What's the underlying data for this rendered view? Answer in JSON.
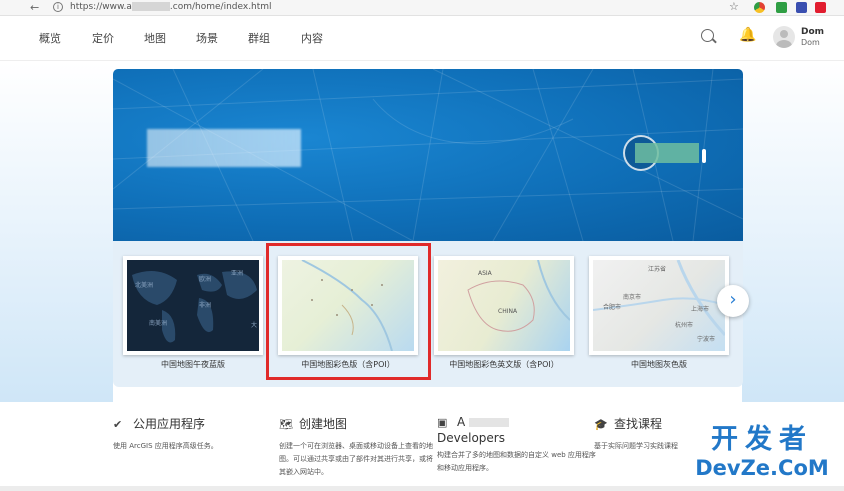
{
  "browser": {
    "url_prefix": "https://www.a",
    "url_suffix": ".com/home/index.html"
  },
  "nav": {
    "items": [
      "概览",
      "定价",
      "地图",
      "场景",
      "群组",
      "内容"
    ],
    "user_name": "Dom",
    "user_handle": "Dom"
  },
  "gallery": {
    "cards": [
      {
        "label": "中国地图午夜蓝版",
        "map_text": [
          "北美洲",
          "欧洲",
          "亚洲",
          "非洲",
          "南美洲",
          "大"
        ]
      },
      {
        "label": "中国地图彩色版（含POI）",
        "map_text": []
      },
      {
        "label": "中国地图彩色英文版（含POI）",
        "map_text": [
          "ASIA",
          "CHINA"
        ]
      },
      {
        "label": "中国地图灰色版",
        "map_text": [
          "江苏省",
          "南京市",
          "合肥市",
          "上海市",
          "杭州市",
          "宁波市"
        ]
      }
    ],
    "next": "›"
  },
  "features": [
    {
      "icon": "✔",
      "title": "公用应用程序",
      "desc": "使用 ArcGIS 应用程序高级任务。"
    },
    {
      "icon": "🗺",
      "title": "创建地图",
      "desc": "创建一个可在浏览器、桌面或移动设备上查看的地图。可以通过共享或由了部件对其进行共享，或将其嵌入网站中。"
    },
    {
      "icon": "▣",
      "title_prefix": "A",
      "title_suffix": "Developers",
      "desc": "构建合并了多的地图和数据的自定义 web 应用程序和移动应用程序。"
    },
    {
      "icon": "🎓",
      "title": "查找课程",
      "desc": "基于实际问题学习实践课程"
    }
  ],
  "watermark": {
    "line1": "开发者",
    "line2": "DevZe.CoM"
  }
}
